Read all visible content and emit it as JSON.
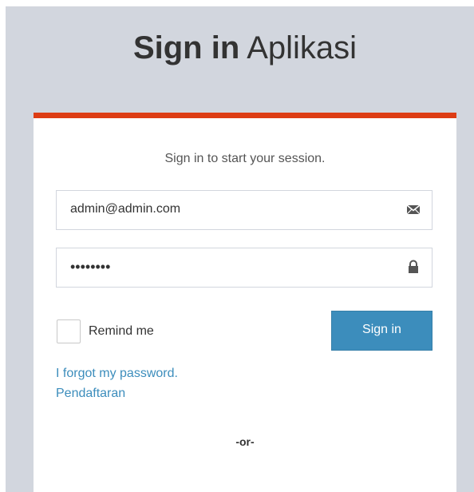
{
  "logo": {
    "bold": "Sign in",
    "light": "Aplikasi"
  },
  "login": {
    "message": "Sign in to start your session.",
    "email_value": "admin@admin.com",
    "password_value": "12345678",
    "email_icon": "envelope-icon",
    "password_icon": "lock-icon",
    "remember_label": "Remind me",
    "signin_label": "Sign in",
    "forgot_link": "I forgot my password.",
    "register_link": "Pendaftaran",
    "or_text": "-or-"
  },
  "colors": {
    "accent_top_border": "#dd3c14",
    "background": "#d2d6de",
    "primary_button": "#3c8dbc",
    "link": "#3c8dbc"
  }
}
